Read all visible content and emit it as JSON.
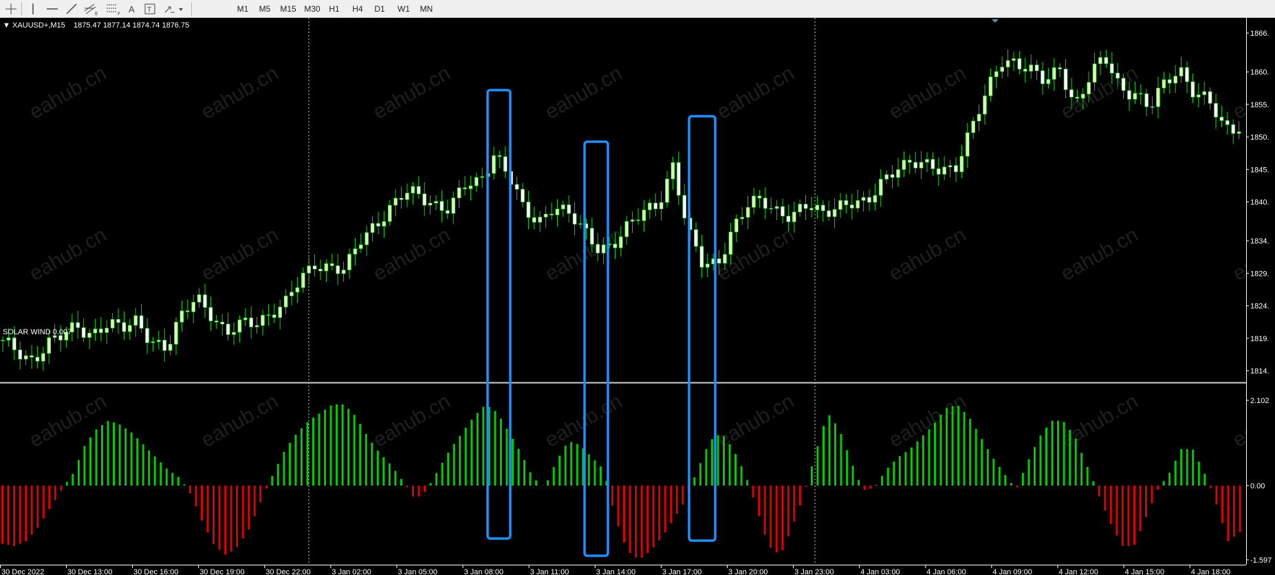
{
  "toolbar": {
    "timeframes": [
      "M1",
      "M5",
      "M15",
      "M30",
      "H1",
      "H4",
      "D1",
      "W1",
      "MN"
    ]
  },
  "header": {
    "symbol": "XAUUSD+,M15",
    "ohlc": "1875.47 1877.14 1874.74 1876.75"
  },
  "indicator": {
    "title": "SOLAR WIND 0.007"
  },
  "price_axis": {
    "labels": [
      "1866.",
      "1860.",
      "1855.",
      "1850.",
      "1845.",
      "1840.",
      "1834.",
      "1829.",
      "1824.",
      "1819.",
      "1814."
    ]
  },
  "indicator_axis": {
    "labels": [
      "2.102",
      "0.00",
      "-1.597"
    ]
  },
  "time_axis": {
    "labels": [
      "30 Dec 2022",
      "30 Dec 13:00",
      "30 Dec 16:00",
      "30 Dec 19:00",
      "30 Dec 22:00",
      "3 Jan 02:00",
      "3 Jan 05:00",
      "3 Jan 08:00",
      "3 Jan 11:00",
      "3 Jan 14:00",
      "3 Jan 17:00",
      "3 Jan 20:00",
      "3 Jan 23:00",
      "4 Jan 03:00",
      "4 Jan 06:00",
      "4 Jan 09:00",
      "4 Jan 12:00",
      "4 Jan 15:00",
      "4 Jan 18:00"
    ]
  },
  "watermark": "eahub.cn",
  "colors": {
    "background": "#000000",
    "bull_candle": "#d2ffb4",
    "bear_candle": "#ffffff",
    "wick": "#00e000",
    "hist_positive": "#00cc00",
    "hist_negative": "#dd0000",
    "highlight_box": "#1e90ff",
    "axis_text": "#ffffff"
  },
  "chart_data": {
    "type": "candlestick",
    "symbol": "XAUUSD+",
    "timeframe": "M15",
    "ohlc_series_approx_close": [
      1818,
      1817,
      1816,
      1818,
      1819,
      1821,
      1820,
      1821,
      1820,
      1822,
      1819,
      1817,
      1822,
      1826,
      1823,
      1819,
      1821,
      1822,
      1823,
      1824,
      1828,
      1831,
      1830,
      1829,
      1834,
      1837,
      1839,
      1841,
      1841,
      1840,
      1839,
      1842,
      1843,
      1848,
      1844,
      1838,
      1837,
      1840,
      1838,
      1835,
      1833,
      1834,
      1836,
      1838,
      1840,
      1846,
      1835,
      1830,
      1831,
      1836,
      1839,
      1840,
      1839,
      1838,
      1839,
      1838,
      1840,
      1840,
      1839,
      1843,
      1846,
      1846,
      1845,
      1845,
      1846,
      1851,
      1856,
      1862,
      1862,
      1860,
      1858,
      1861,
      1855,
      1859,
      1862,
      1858,
      1857,
      1854,
      1858,
      1861,
      1857,
      1855,
      1851,
      1852
    ],
    "indicator": {
      "name": "SOLAR WIND 0.007",
      "ylim": [
        -1.597,
        2.102
      ],
      "values": [
        -1.25,
        -1.3,
        -1.2,
        -0.9,
        -0.5,
        -0.1,
        0.3,
        1.0,
        1.4,
        1.6,
        1.5,
        1.3,
        1.0,
        0.7,
        0.4,
        0.2,
        -0.2,
        -0.8,
        -1.3,
        -1.5,
        -1.3,
        -0.9,
        -0.3,
        0.3,
        0.9,
        1.3,
        1.6,
        1.8,
        2.0,
        2.0,
        1.7,
        1.2,
        0.8,
        0.5,
        0.1,
        -0.3,
        -0.1,
        0.4,
        0.9,
        1.3,
        1.7,
        2.0,
        1.8,
        1.3,
        0.8,
        0.2,
        -0.05,
        0.6,
        1.1,
        1.0,
        0.7,
        0.4,
        -0.7,
        -1.4,
        -1.6,
        -1.4,
        -1.1,
        -0.7,
        -0.3,
        0.4,
        1.1,
        1.3,
        0.9,
        0.3,
        -0.5,
        -1.3,
        -1.5,
        -0.9,
        -0.2,
        0.8,
        1.8,
        1.4,
        0.6,
        -0.1,
        -0.05,
        0.4,
        0.7,
        0.9,
        1.2,
        1.5,
        1.9,
        2.0,
        1.7,
        1.2,
        0.7,
        0.3,
        -0.1,
        0.6,
        1.2,
        1.6,
        1.6,
        1.2,
        0.5,
        -0.2,
        -0.8,
        -1.3,
        -1.3,
        -0.7,
        -0.1,
        0.3,
        0.9,
        0.9,
        0.3,
        -0.4,
        -1.2,
        -1.0
      ]
    },
    "highlighted_regions": 3
  }
}
